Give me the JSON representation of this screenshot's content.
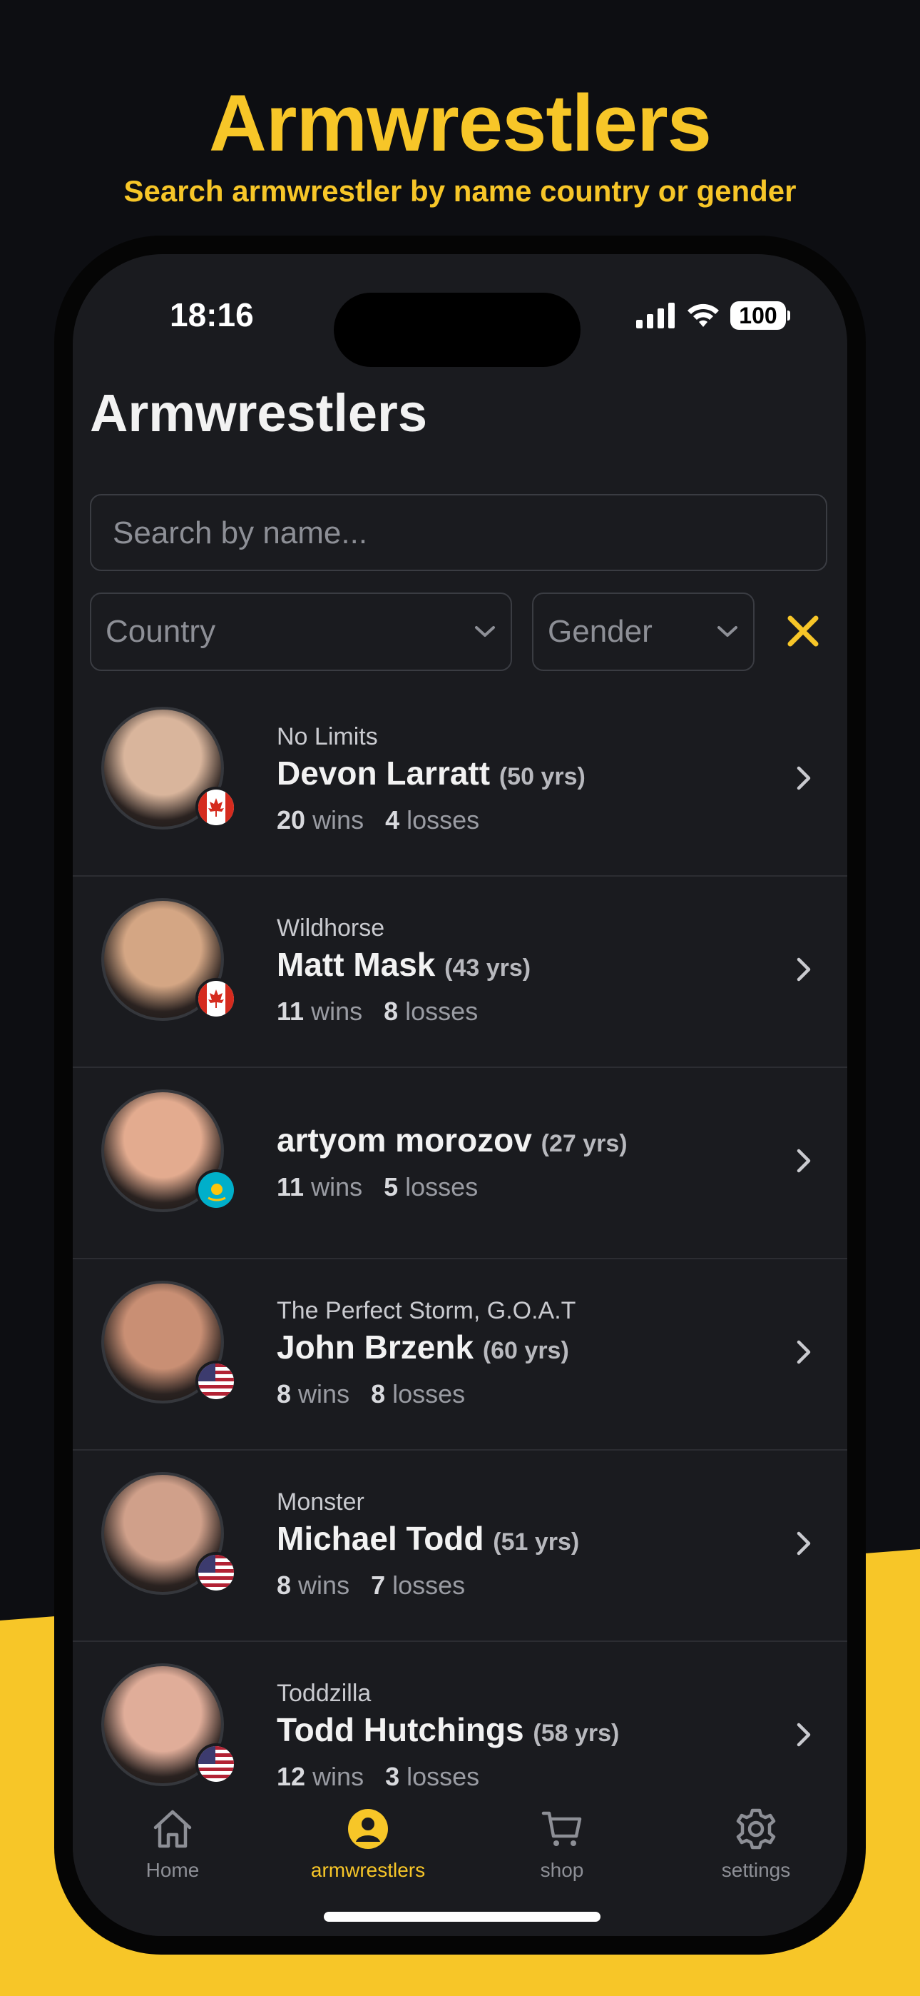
{
  "promo": {
    "title": "Armwrestlers",
    "subtitle": "Search armwrestler by name country or gender"
  },
  "status_bar": {
    "time": "18:16",
    "battery": "100"
  },
  "screen": {
    "title": "Armwrestlers",
    "search_placeholder": "Search by name...",
    "filters": {
      "country": "Country",
      "gender": "Gender"
    }
  },
  "wrestlers": [
    {
      "nickname": "No Limits",
      "name": "Devon Larratt",
      "age": "(50 yrs)",
      "wins": "20",
      "losses": "4",
      "flag": "canada",
      "skin": "#d9b59c"
    },
    {
      "nickname": "Wildhorse",
      "name": "Matt Mask",
      "age": "(43 yrs)",
      "wins": "11",
      "losses": "8",
      "flag": "canada",
      "skin": "#d4a684"
    },
    {
      "nickname": "",
      "name": "artyom morozov",
      "age": "(27 yrs)",
      "wins": "11",
      "losses": "5",
      "flag": "kazakhstan",
      "skin": "#e3ab8f"
    },
    {
      "nickname": "The Perfect Storm, G.O.A.T",
      "name": "John Brzenk",
      "age": "(60 yrs)",
      "wins": "8",
      "losses": "8",
      "flag": "usa",
      "skin": "#c98f74"
    },
    {
      "nickname": "Monster",
      "name": "Michael Todd",
      "age": "(51 yrs)",
      "wins": "8",
      "losses": "7",
      "flag": "usa",
      "skin": "#d0a08a"
    },
    {
      "nickname": "Toddzilla",
      "name": "Todd Hutchings",
      "age": "(58 yrs)",
      "wins": "12",
      "losses": "3",
      "flag": "usa",
      "skin": "#e0ad99"
    }
  ],
  "labels": {
    "wins": "wins",
    "losses": "losses"
  },
  "tabs": [
    {
      "label": "Home",
      "icon": "home-icon"
    },
    {
      "label": "armwrestlers",
      "icon": "user-icon"
    },
    {
      "label": "shop",
      "icon": "cart-icon"
    },
    {
      "label": "settings",
      "icon": "gear-icon"
    }
  ],
  "colors": {
    "accent": "#f7c628",
    "background": "#0d0e12",
    "screen": "#1a1b1f"
  }
}
